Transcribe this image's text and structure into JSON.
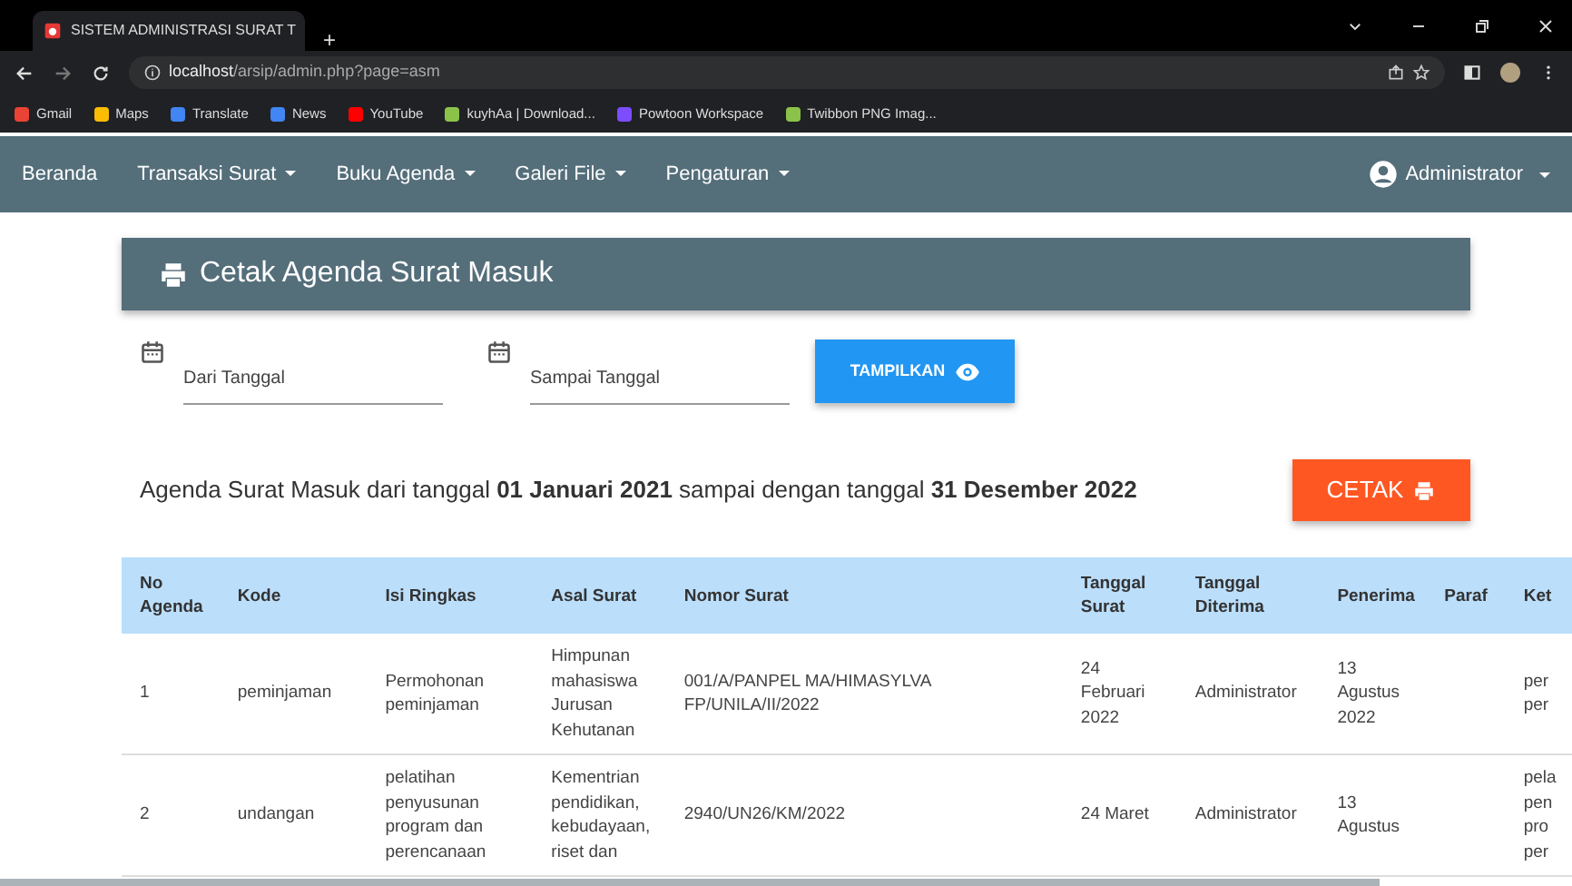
{
  "browser": {
    "tab_title": "SISTEM ADMINISTRASI SURAT T",
    "new_tab": "+",
    "url_host": "localhost",
    "url_path": "/arsip/admin.php?page=asm",
    "bookmarks": [
      {
        "label": "Gmail",
        "color": "#ea4335"
      },
      {
        "label": "Maps",
        "color": "#fbbc04"
      },
      {
        "label": "Translate",
        "color": "#4285f4"
      },
      {
        "label": "News",
        "color": "#4285f4"
      },
      {
        "label": "YouTube",
        "color": "#ff0000"
      },
      {
        "label": "kuyhAa | Download...",
        "color": "#8bc34a"
      },
      {
        "label": "Powtoon Workspace",
        "color": "#7c4dff"
      },
      {
        "label": "Twibbon PNG Imag...",
        "color": "#8bc34a"
      }
    ]
  },
  "navbar": {
    "items": [
      {
        "label": "Beranda",
        "dropdown": false
      },
      {
        "label": "Transaksi Surat",
        "dropdown": true
      },
      {
        "label": "Buku Agenda",
        "dropdown": true
      },
      {
        "label": "Galeri File",
        "dropdown": true
      },
      {
        "label": "Pengaturan",
        "dropdown": true
      }
    ],
    "user": "Administrator"
  },
  "page_title": "Cetak Agenda Surat Masuk",
  "filters": [
    {
      "placeholder": "Dari Tanggal"
    },
    {
      "placeholder": "Sampai Tanggal"
    }
  ],
  "show_button": "TAMPILKAN",
  "summary": "Agenda Surat Masuk dari tanggal **01 Januari 2021** sampai dengan tanggal **31 Desember 2022**",
  "print_button": "CETAK",
  "table": {
    "columns": [
      "No Agenda",
      "Kode",
      "Isi Ringkas",
      "Asal Surat",
      "Nomor Surat",
      "Tanggal Surat",
      "Tanggal Diterima",
      "Penerima",
      "Paraf",
      "Ket"
    ],
    "rows": [
      [
        "1",
        "peminjaman",
        "Permohonan peminjaman",
        "Himpunan mahasiswa Jurusan Kehutanan",
        "001/A/PANPEL MA/HIMASYLVA FP/UNILA/II/2022",
        "24 Februari 2022",
        "Administrator",
        "13 Agustus 2022",
        "",
        "per per"
      ],
      [
        "2",
        "undangan",
        "pelatihan penyusunan program dan perencanaan",
        "Kementrian pendidikan, kebudayaan, riset dan",
        "2940/UN26/KM/2022",
        "24 Maret",
        "Administrator",
        "13 Agustus",
        "",
        "pela pen pro per"
      ]
    ]
  }
}
